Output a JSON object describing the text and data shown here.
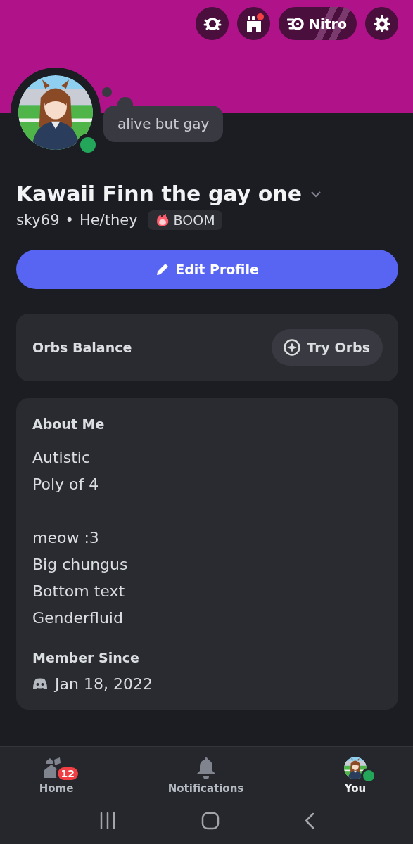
{
  "top_buttons": [
    {
      "kind": "quests"
    },
    {
      "kind": "shop",
      "notification": true
    },
    {
      "kind": "nitro",
      "label": "Nitro"
    },
    {
      "kind": "settings"
    }
  ],
  "profile": {
    "online": true,
    "custom_status": "alive but gay",
    "display_name": "Kawaii Finn the gay one",
    "username": "sky69",
    "separator": "•",
    "pronouns": "He/they",
    "tag": "BOOM"
  },
  "edit_button": "Edit Profile",
  "orbs": {
    "label": "Orbs Balance",
    "button": "Try Orbs"
  },
  "about": {
    "heading": "About Me",
    "paragraphs": [
      "Autistic\nPoly of 4",
      "meow :3\nBig chungus\nBottom text\nGenderfluid"
    ],
    "member_heading": "Member Since",
    "member_date": "Jan 18, 2022"
  },
  "nav": [
    {
      "kind": "home",
      "label": "Home",
      "badge": "12",
      "selected": false
    },
    {
      "kind": "notifications",
      "label": "Notifications",
      "selected": false
    },
    {
      "kind": "you",
      "label": "You",
      "selected": true
    }
  ]
}
